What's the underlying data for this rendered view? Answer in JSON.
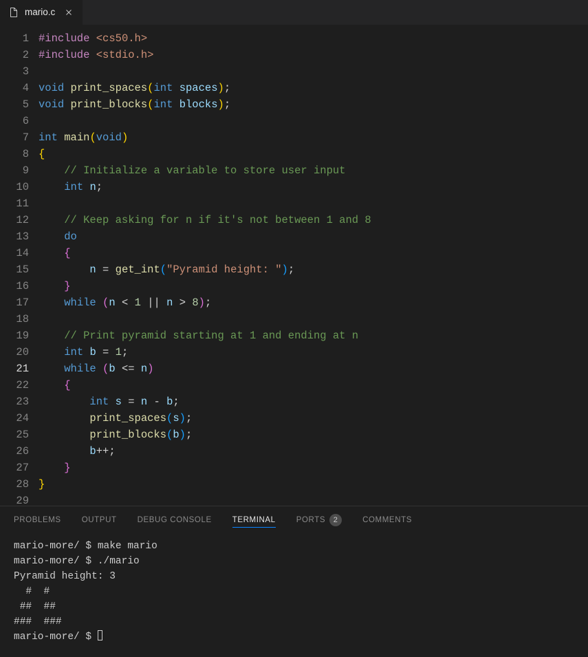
{
  "tab": {
    "filename": "mario.c"
  },
  "editor": {
    "active_line": 21,
    "lines": [
      [
        {
          "c": "t-pre",
          "t": "#include"
        },
        {
          "c": "t-punc",
          "t": " "
        },
        {
          "c": "t-inc",
          "t": "<cs50.h>"
        }
      ],
      [
        {
          "c": "t-pre",
          "t": "#include"
        },
        {
          "c": "t-punc",
          "t": " "
        },
        {
          "c": "t-inc",
          "t": "<stdio.h>"
        }
      ],
      [],
      [
        {
          "c": "t-kw",
          "t": "void"
        },
        {
          "c": "t-punc",
          "t": " "
        },
        {
          "c": "t-fn",
          "t": "print_spaces"
        },
        {
          "c": "t-bracket-y",
          "t": "("
        },
        {
          "c": "t-kw",
          "t": "int"
        },
        {
          "c": "t-punc",
          "t": " "
        },
        {
          "c": "t-var",
          "t": "spaces"
        },
        {
          "c": "t-bracket-y",
          "t": ")"
        },
        {
          "c": "t-punc",
          "t": ";"
        }
      ],
      [
        {
          "c": "t-kw",
          "t": "void"
        },
        {
          "c": "t-punc",
          "t": " "
        },
        {
          "c": "t-fn",
          "t": "print_blocks"
        },
        {
          "c": "t-bracket-y",
          "t": "("
        },
        {
          "c": "t-kw",
          "t": "int"
        },
        {
          "c": "t-punc",
          "t": " "
        },
        {
          "c": "t-var",
          "t": "blocks"
        },
        {
          "c": "t-bracket-y",
          "t": ")"
        },
        {
          "c": "t-punc",
          "t": ";"
        }
      ],
      [],
      [
        {
          "c": "t-kw",
          "t": "int"
        },
        {
          "c": "t-punc",
          "t": " "
        },
        {
          "c": "t-fn",
          "t": "main"
        },
        {
          "c": "t-bracket-y",
          "t": "("
        },
        {
          "c": "t-kw",
          "t": "void"
        },
        {
          "c": "t-bracket-y",
          "t": ")"
        }
      ],
      [
        {
          "c": "t-bracket-y",
          "t": "{"
        }
      ],
      [
        {
          "c": "",
          "t": "    "
        },
        {
          "c": "t-comm",
          "t": "// Initialize a variable to store user input"
        }
      ],
      [
        {
          "c": "",
          "t": "    "
        },
        {
          "c": "t-kw",
          "t": "int"
        },
        {
          "c": "t-punc",
          "t": " "
        },
        {
          "c": "t-var",
          "t": "n"
        },
        {
          "c": "t-punc",
          "t": ";"
        }
      ],
      [],
      [
        {
          "c": "",
          "t": "    "
        },
        {
          "c": "t-comm",
          "t": "// Keep asking for n if it's not between 1 and 8"
        }
      ],
      [
        {
          "c": "",
          "t": "    "
        },
        {
          "c": "t-kw",
          "t": "do"
        }
      ],
      [
        {
          "c": "",
          "t": "    "
        },
        {
          "c": "t-bracket-p",
          "t": "{"
        }
      ],
      [
        {
          "c": "",
          "t": "        "
        },
        {
          "c": "t-var",
          "t": "n"
        },
        {
          "c": "t-punc",
          "t": " = "
        },
        {
          "c": "t-fn",
          "t": "get_int"
        },
        {
          "c": "t-bracket-b",
          "t": "("
        },
        {
          "c": "t-str",
          "t": "\"Pyramid height: \""
        },
        {
          "c": "t-bracket-b",
          "t": ")"
        },
        {
          "c": "t-punc",
          "t": ";"
        }
      ],
      [
        {
          "c": "",
          "t": "    "
        },
        {
          "c": "t-bracket-p",
          "t": "}"
        }
      ],
      [
        {
          "c": "",
          "t": "    "
        },
        {
          "c": "t-kw",
          "t": "while"
        },
        {
          "c": "t-punc",
          "t": " "
        },
        {
          "c": "t-bracket-p",
          "t": "("
        },
        {
          "c": "t-var",
          "t": "n"
        },
        {
          "c": "t-punc",
          "t": " < "
        },
        {
          "c": "t-num",
          "t": "1"
        },
        {
          "c": "t-punc",
          "t": " || "
        },
        {
          "c": "t-var",
          "t": "n"
        },
        {
          "c": "t-punc",
          "t": " > "
        },
        {
          "c": "t-num",
          "t": "8"
        },
        {
          "c": "t-bracket-p",
          "t": ")"
        },
        {
          "c": "t-punc",
          "t": ";"
        }
      ],
      [],
      [
        {
          "c": "",
          "t": "    "
        },
        {
          "c": "t-comm",
          "t": "// Print pyramid starting at 1 and ending at n"
        }
      ],
      [
        {
          "c": "",
          "t": "    "
        },
        {
          "c": "t-kw",
          "t": "int"
        },
        {
          "c": "t-punc",
          "t": " "
        },
        {
          "c": "t-var",
          "t": "b"
        },
        {
          "c": "t-punc",
          "t": " = "
        },
        {
          "c": "t-num",
          "t": "1"
        },
        {
          "c": "t-punc",
          "t": ";"
        }
      ],
      [
        {
          "c": "",
          "t": "    "
        },
        {
          "c": "t-kw",
          "t": "while"
        },
        {
          "c": "t-punc",
          "t": " "
        },
        {
          "c": "t-bracket-p",
          "t": "("
        },
        {
          "c": "t-var",
          "t": "b"
        },
        {
          "c": "t-punc",
          "t": " <= "
        },
        {
          "c": "t-var",
          "t": "n"
        },
        {
          "c": "t-bracket-p",
          "t": ")"
        }
      ],
      [
        {
          "c": "",
          "t": "    "
        },
        {
          "c": "t-bracket-p",
          "t": "{"
        }
      ],
      [
        {
          "c": "",
          "t": "        "
        },
        {
          "c": "t-kw",
          "t": "int"
        },
        {
          "c": "t-punc",
          "t": " "
        },
        {
          "c": "t-var",
          "t": "s"
        },
        {
          "c": "t-punc",
          "t": " = "
        },
        {
          "c": "t-var",
          "t": "n"
        },
        {
          "c": "t-punc",
          "t": " - "
        },
        {
          "c": "t-var",
          "t": "b"
        },
        {
          "c": "t-punc",
          "t": ";"
        }
      ],
      [
        {
          "c": "",
          "t": "        "
        },
        {
          "c": "t-fn",
          "t": "print_spaces"
        },
        {
          "c": "t-bracket-b",
          "t": "("
        },
        {
          "c": "t-var",
          "t": "s"
        },
        {
          "c": "t-bracket-b",
          "t": ")"
        },
        {
          "c": "t-punc",
          "t": ";"
        }
      ],
      [
        {
          "c": "",
          "t": "        "
        },
        {
          "c": "t-fn",
          "t": "print_blocks"
        },
        {
          "c": "t-bracket-b",
          "t": "("
        },
        {
          "c": "t-var",
          "t": "b"
        },
        {
          "c": "t-bracket-b",
          "t": ")"
        },
        {
          "c": "t-punc",
          "t": ";"
        }
      ],
      [
        {
          "c": "",
          "t": "        "
        },
        {
          "c": "t-var",
          "t": "b"
        },
        {
          "c": "t-punc",
          "t": "++;"
        }
      ],
      [
        {
          "c": "",
          "t": "    "
        },
        {
          "c": "t-bracket-p",
          "t": "}"
        }
      ],
      [
        {
          "c": "t-bracket-y",
          "t": "}"
        }
      ],
      []
    ]
  },
  "panel": {
    "tabs": {
      "problems": "PROBLEMS",
      "output": "OUTPUT",
      "debug": "DEBUG CONSOLE",
      "terminal": "TERMINAL",
      "ports": "PORTS",
      "ports_badge": "2",
      "comments": "COMMENTS"
    },
    "terminal_lines": [
      "mario-more/ $ make mario",
      "mario-more/ $ ./mario",
      "Pyramid height: 3",
      "  #  #",
      " ##  ##",
      "###  ###",
      "mario-more/ $ "
    ]
  }
}
